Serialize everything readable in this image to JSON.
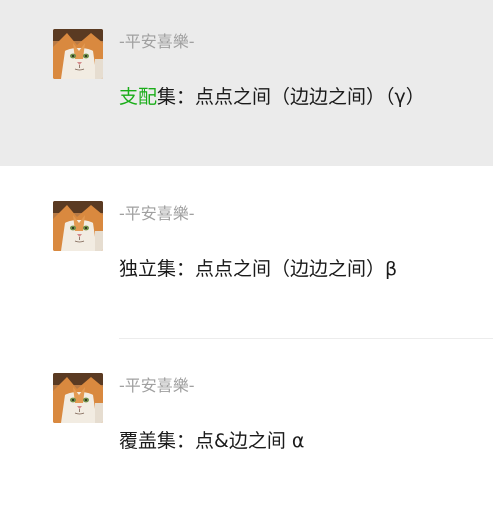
{
  "messages": [
    {
      "sender": "-平安喜樂-",
      "content_highlight": "支配",
      "content_rest": "集：点点之间（边边之间）（γ）",
      "highlight_color": "#1aad19"
    },
    {
      "sender": "-平安喜樂-",
      "content": "独立集：点点之间（边边之间）β"
    },
    {
      "sender": "-平安喜樂-",
      "content": "覆盖集：点&边之间 α"
    }
  ]
}
